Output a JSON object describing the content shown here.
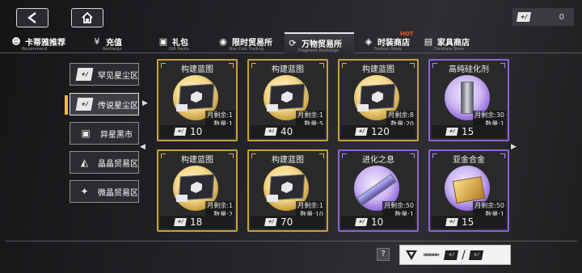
{
  "header": {
    "back_icon": "back-arrow-icon",
    "home_icon": "home-icon",
    "currency_value": "0",
    "currency_tag": "+/"
  },
  "tabs": [
    {
      "label": "卡蒂雅推荐",
      "sub": "Recommend",
      "icon": "mascot-icon"
    },
    {
      "label": "充值",
      "sub": "Recharge",
      "icon": "yen-icon"
    },
    {
      "label": "礼包",
      "sub": "Gift Packs",
      "icon": "gift-icon"
    },
    {
      "label": "限时贸易所",
      "sub": "Star Coin Trading",
      "icon": "timed-trade-icon"
    },
    {
      "label": "万物贸易所",
      "sub": "Fragment Exchange",
      "icon": "exchange-icon",
      "active": true
    },
    {
      "label": "时装商店",
      "sub": "Fashion Store",
      "icon": "fashion-icon"
    },
    {
      "label": "家具商店",
      "sub": "Furniture Store",
      "icon": "furniture-icon"
    }
  ],
  "hot_badge": "HOT",
  "sidebar": [
    {
      "label": "罕见星尘区",
      "icon": "rare-stardust-icon"
    },
    {
      "label": "传说星尘区",
      "icon": "legend-stardust-icon",
      "active": true
    },
    {
      "label": "异星黑市",
      "icon": "black-market-icon"
    },
    {
      "label": "晶晶贸易区",
      "icon": "crystal-trade-icon"
    },
    {
      "label": "微晶贸易区",
      "icon": "microcrystal-trade-icon"
    }
  ],
  "cards": [
    {
      "title": "构建蓝图",
      "remain": "月剩余:1",
      "qty": "数量:1",
      "price": "10",
      "rarity": "gold",
      "item": "blueprint"
    },
    {
      "title": "构建蓝图",
      "remain": "月剩余:1",
      "qty": "数量:5",
      "price": "40",
      "rarity": "gold",
      "item": "blueprint"
    },
    {
      "title": "构建蓝图",
      "remain": "月剩余:8",
      "qty": "数量:20",
      "price": "120",
      "rarity": "gold",
      "item": "blueprint"
    },
    {
      "title": "高纯硅化剂",
      "remain": "月剩余:30",
      "qty": "数量:1",
      "price": "15",
      "rarity": "purple",
      "item": "tube"
    },
    {
      "title": "构建蓝图",
      "remain": "月剩余:1",
      "qty": "数量:2",
      "price": "18",
      "rarity": "gold",
      "item": "blueprint"
    },
    {
      "title": "构建蓝图",
      "remain": "月剩余:1",
      "qty": "数量:10",
      "price": "70",
      "rarity": "gold",
      "item": "blueprint"
    },
    {
      "title": "进化之息",
      "remain": "月剩余:50",
      "qty": "数量:1",
      "price": "10",
      "rarity": "purple",
      "item": "stick"
    },
    {
      "title": "亚金合金",
      "remain": "月剩余:50",
      "qty": "数量:1",
      "price": "15",
      "rarity": "purple",
      "item": "gold"
    }
  ],
  "price_currency_tag": "+/",
  "footer": {
    "help_label": "?",
    "exchange_chevrons": "»»»»»",
    "exchange_slash": "/",
    "exchange_tag_a": "+/",
    "exchange_tag_b": "+/"
  }
}
